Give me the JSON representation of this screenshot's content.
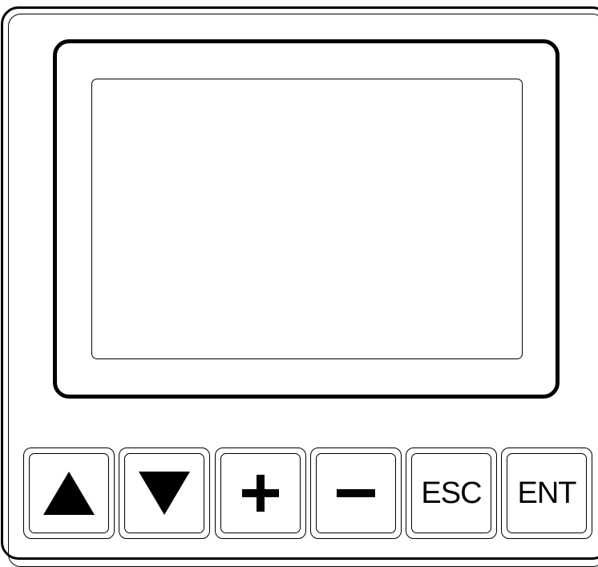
{
  "device": {
    "keys": [
      {
        "id": "up",
        "icon": "triangle-up-icon",
        "label": ""
      },
      {
        "id": "down",
        "icon": "triangle-down-icon",
        "label": ""
      },
      {
        "id": "plus",
        "icon": "plus-icon",
        "label": ""
      },
      {
        "id": "minus",
        "icon": "minus-icon",
        "label": ""
      },
      {
        "id": "esc",
        "icon": "",
        "label": "ESC"
      },
      {
        "id": "ent",
        "icon": "",
        "label": "ENT"
      }
    ],
    "colors": {
      "outline": "#000000",
      "background": "#ffffff"
    }
  }
}
